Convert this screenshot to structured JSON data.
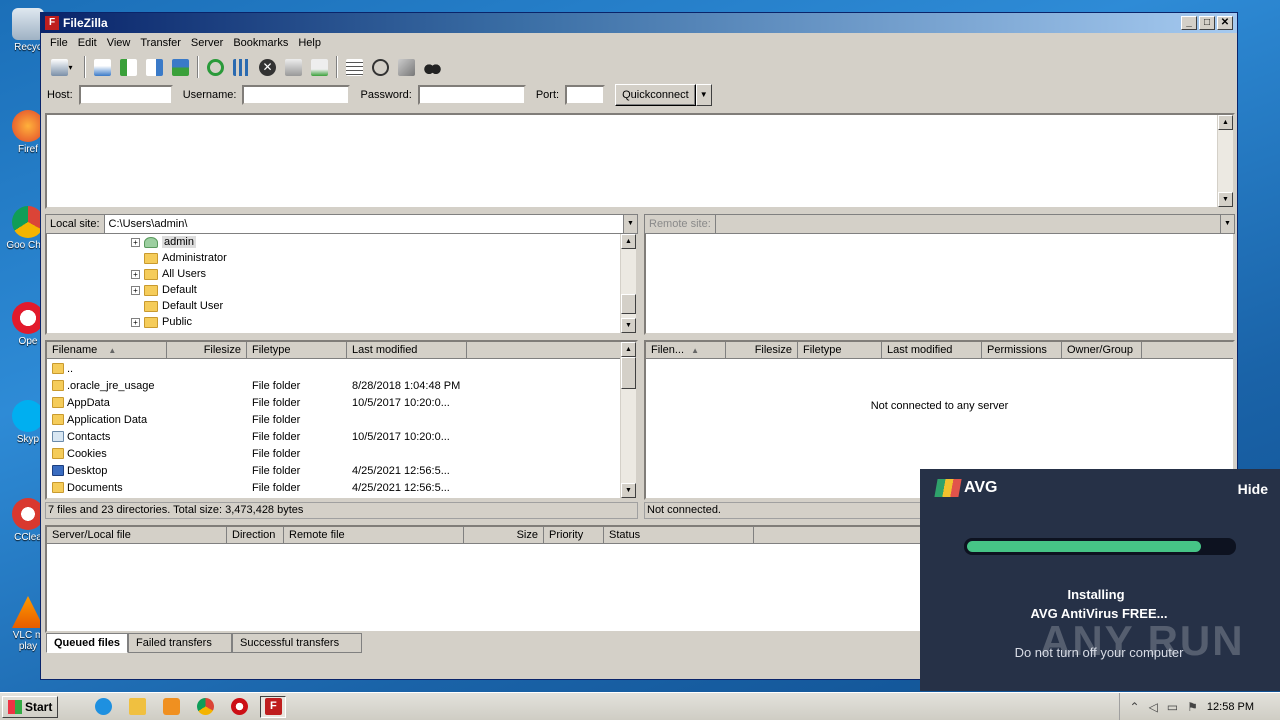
{
  "desktop": {
    "icons": [
      "Recyc",
      "Firef",
      "Goo Chro",
      "Ope",
      "Skyp",
      "CClea",
      "VLC m play"
    ]
  },
  "window": {
    "title": "FileZilla",
    "controls": {
      "minimize": "_",
      "maximize": "□",
      "close": "✕"
    }
  },
  "menu": [
    "File",
    "Edit",
    "View",
    "Transfer",
    "Server",
    "Bookmarks",
    "Help"
  ],
  "quickconnect": {
    "host_label": "Host:",
    "username_label": "Username:",
    "password_label": "Password:",
    "port_label": "Port:",
    "host_value": "",
    "username_value": "",
    "password_value": "",
    "port_value": "",
    "button": "Quickconnect"
  },
  "local": {
    "site_label": "Local site:",
    "site_path": "C:\\Users\\admin\\",
    "tree": [
      {
        "name": "admin",
        "expander": "+",
        "selected": true
      },
      {
        "name": "Administrator",
        "expander": ""
      },
      {
        "name": "All Users",
        "expander": "+"
      },
      {
        "name": "Default",
        "expander": "+"
      },
      {
        "name": "Default User",
        "expander": ""
      },
      {
        "name": "Public",
        "expander": "+"
      }
    ],
    "columns": [
      "Filename",
      "Filesize",
      "Filetype",
      "Last modified"
    ],
    "files": [
      {
        "name": "..",
        "type": "",
        "modified": ""
      },
      {
        "name": ".oracle_jre_usage",
        "type": "File folder",
        "modified": "8/28/2018 1:04:48 PM"
      },
      {
        "name": "AppData",
        "type": "File folder",
        "modified": "10/5/2017 10:20:0..."
      },
      {
        "name": "Application Data",
        "type": "File folder",
        "modified": ""
      },
      {
        "name": "Contacts",
        "type": "File folder",
        "modified": "10/5/2017 10:20:0..."
      },
      {
        "name": "Cookies",
        "type": "File folder",
        "modified": ""
      },
      {
        "name": "Desktop",
        "type": "File folder",
        "modified": "4/25/2021 12:56:5..."
      },
      {
        "name": "Documents",
        "type": "File folder",
        "modified": "4/25/2021 12:56:5..."
      }
    ],
    "status": "7 files and 23 directories. Total size: 3,473,428 bytes"
  },
  "remote": {
    "site_label": "Remote site:",
    "columns": [
      "Filen...",
      "Filesize",
      "Filetype",
      "Last modified",
      "Permissions",
      "Owner/Group"
    ],
    "empty_message": "Not connected to any server",
    "status": "Not connected."
  },
  "queue": {
    "columns": [
      "Server/Local file",
      "Direction",
      "Remote file",
      "Size",
      "Priority",
      "Status"
    ],
    "tabs": [
      "Queued files",
      "Failed transfers",
      "Successful transfers"
    ]
  },
  "avg": {
    "brand": "AVG",
    "hide": "Hide",
    "progress": 0.88,
    "line1": "Installing",
    "line2": "AVG AntiVirus FREE...",
    "line3": "Do not turn off your computer",
    "watermark": "ANY RUN"
  },
  "taskbar": {
    "start": "Start",
    "clock": "12:58 PM"
  }
}
